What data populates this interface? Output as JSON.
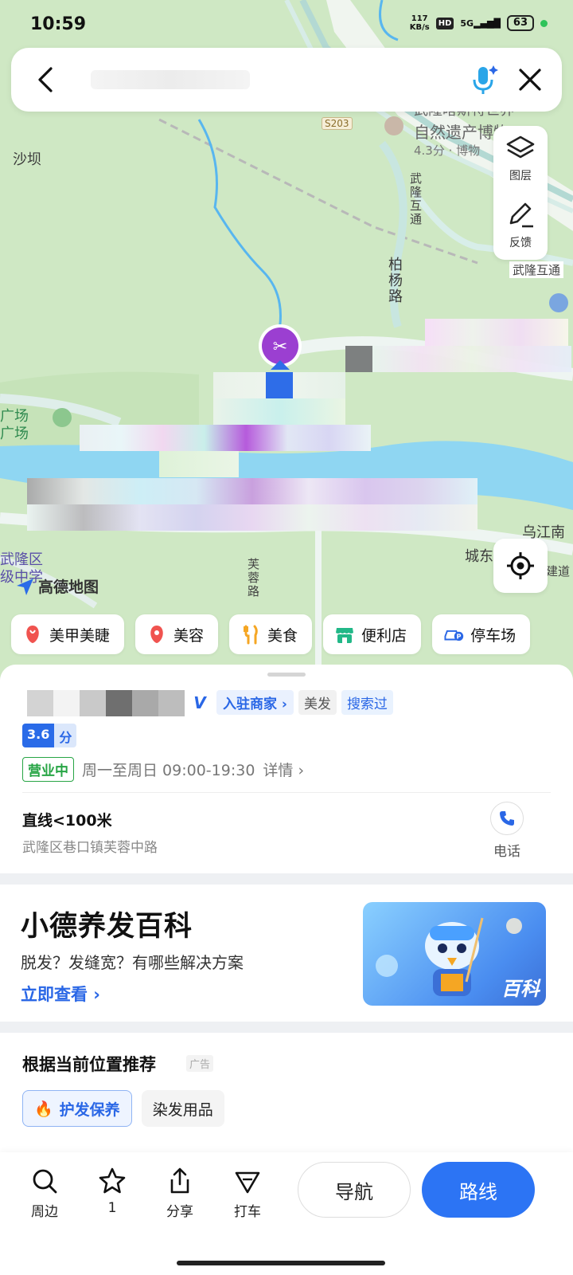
{
  "status": {
    "time": "10:59",
    "speed_top": "117",
    "speed_unit": "KB/s",
    "hd": "HD",
    "network": "5G",
    "battery": "63"
  },
  "search": {
    "placeholder": ""
  },
  "map": {
    "labels": {
      "shaba": "沙坝",
      "museum": "武隆喀斯特世界自然遗产博物馆",
      "museum_line1": "武隆喀斯特世界",
      "museum_line2": "自然遗产博物",
      "museum_rating": "4.3分 · 博物",
      "road_s203": "S203",
      "wulong_interchange_v": "武隆互通",
      "wulong_interchange": "武隆互通",
      "baiyang_road": "柏杨路",
      "plaza1": "广场",
      "plaza2": "广场",
      "wujiang": "乌江南",
      "chengdong": "城东",
      "wulong_district": "武隆区",
      "middle_school": "级中学",
      "furong_road": "芙蓉路",
      "jiandao": "建道"
    },
    "logo_text": "高德地图",
    "tools": {
      "layers_label": "图层",
      "feedback_label": "反馈"
    },
    "pin_icon": "scissors-icon"
  },
  "categories": [
    {
      "label": "美甲美睫",
      "icon": "nail-icon",
      "color": "#f0534f"
    },
    {
      "label": "美容",
      "icon": "beauty-icon",
      "color": "#f0534f"
    },
    {
      "label": "美食",
      "icon": "food-icon",
      "color": "#f5a623"
    },
    {
      "label": "便利店",
      "icon": "store-icon",
      "color": "#22b888"
    },
    {
      "label": "停车场",
      "icon": "parking-icon",
      "color": "#2a67e6"
    }
  ],
  "poi": {
    "merchant_tag": "入驻商家",
    "category_tag": "美发",
    "searched_tag": "搜索过",
    "rating_score": "3.6",
    "rating_unit": "分",
    "open_status": "营业中",
    "hours": "周一至周日 09:00-19:30",
    "details": "详情",
    "distance": "直线<100米",
    "address": "武隆区巷口镇芙蓉中路",
    "phone_label": "电话"
  },
  "encyclopedia": {
    "title": "小德养发百科",
    "subtitle": "脱发？发缝宽？有哪些解决方案",
    "link": "立即查看",
    "banner_label": "百科"
  },
  "recommend": {
    "title": "根据当前位置推荐",
    "ad_label": "广告",
    "chips": [
      "护发保养",
      "染发用品"
    ]
  },
  "bottom": {
    "nearby": "周边",
    "favorite_count": "1",
    "share": "分享",
    "taxi": "打车",
    "navigate": "导航",
    "route": "路线"
  },
  "colors": {
    "accent": "#2c74f4",
    "open_green": "#27a545",
    "pin_purple": "#9b3fd1"
  }
}
